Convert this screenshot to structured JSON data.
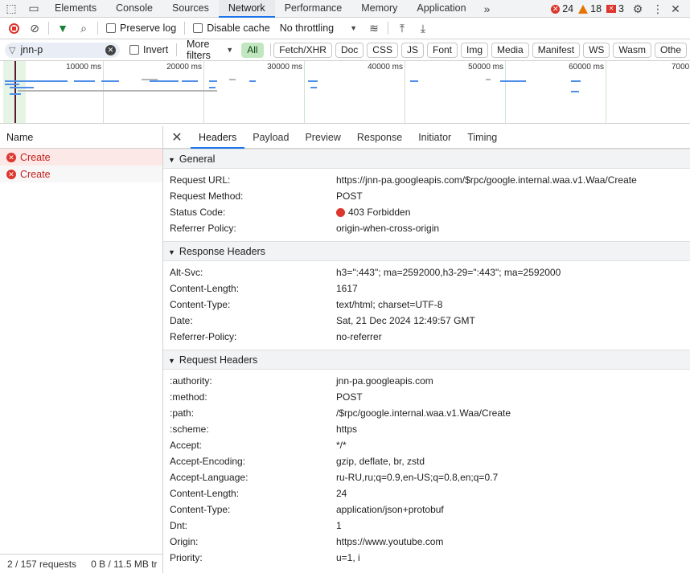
{
  "panel_tabs": [
    "Elements",
    "Console",
    "Sources",
    "Network",
    "Performance",
    "Memory",
    "Application"
  ],
  "counters": {
    "errors": "24",
    "warnings": "18",
    "issues": "3"
  },
  "toolbar": {
    "preserve_log": "Preserve log",
    "disable_cache": "Disable cache",
    "throttling": "No throttling"
  },
  "filter": {
    "search_value": "jnn-p",
    "invert": "Invert",
    "more_filters": "More filters",
    "types": [
      "All",
      "Fetch/XHR",
      "Doc",
      "CSS",
      "JS",
      "Font",
      "Img",
      "Media",
      "Manifest",
      "WS",
      "Wasm",
      "Othe"
    ]
  },
  "overview": {
    "ticks": [
      "10000 ms",
      "20000 ms",
      "30000 ms",
      "40000 ms",
      "50000 ms",
      "60000 ms",
      "7000"
    ]
  },
  "request_list": {
    "header": "Name",
    "rows": [
      "Create",
      "Create"
    ],
    "status_requests": "2 / 157 requests",
    "status_transferred": "0 B / 11.5 MB tr"
  },
  "detail_tabs": [
    "Headers",
    "Payload",
    "Preview",
    "Response",
    "Initiator",
    "Timing"
  ],
  "general": {
    "title": "General",
    "rows": [
      {
        "k": "Request URL:",
        "v": "https://jnn-pa.googleapis.com/$rpc/google.internal.waa.v1.Waa/Create"
      },
      {
        "k": "Request Method:",
        "v": "POST"
      },
      {
        "k": "Status Code:",
        "v": "403 Forbidden"
      },
      {
        "k": "Referrer Policy:",
        "v": "origin-when-cross-origin"
      }
    ]
  },
  "response_headers": {
    "title": "Response Headers",
    "rows": [
      {
        "k": "Alt-Svc:",
        "v": "h3=\":443\"; ma=2592000,h3-29=\":443\"; ma=2592000"
      },
      {
        "k": "Content-Length:",
        "v": "1617"
      },
      {
        "k": "Content-Type:",
        "v": "text/html; charset=UTF-8"
      },
      {
        "k": "Date:",
        "v": "Sat, 21 Dec 2024 12:49:57 GMT"
      },
      {
        "k": "Referrer-Policy:",
        "v": "no-referrer"
      }
    ]
  },
  "request_headers": {
    "title": "Request Headers",
    "rows": [
      {
        "k": ":authority:",
        "v": "jnn-pa.googleapis.com"
      },
      {
        "k": ":method:",
        "v": "POST"
      },
      {
        "k": ":path:",
        "v": "/$rpc/google.internal.waa.v1.Waa/Create"
      },
      {
        "k": ":scheme:",
        "v": "https"
      },
      {
        "k": "Accept:",
        "v": "*/*"
      },
      {
        "k": "Accept-Encoding:",
        "v": "gzip, deflate, br, zstd"
      },
      {
        "k": "Accept-Language:",
        "v": "ru-RU,ru;q=0.9,en-US;q=0.8,en;q=0.7"
      },
      {
        "k": "Content-Length:",
        "v": "24"
      },
      {
        "k": "Content-Type:",
        "v": "application/json+protobuf"
      },
      {
        "k": "Dnt:",
        "v": "1"
      },
      {
        "k": "Origin:",
        "v": "https://www.youtube.com"
      },
      {
        "k": "Priority:",
        "v": "u=1, i"
      }
    ]
  }
}
